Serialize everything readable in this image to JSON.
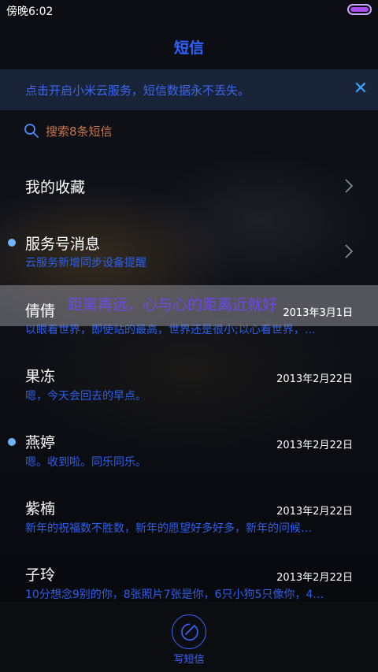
{
  "status_bar": {
    "time": "傍晚6:02"
  },
  "header": {
    "title": "短信"
  },
  "banner": {
    "text": "点击开启小米云服务，短信数据永不丢失。",
    "close_icon": "close-icon"
  },
  "search": {
    "text": "搜索8条短信",
    "icon": "search-icon"
  },
  "favorites": {
    "label": "我的收藏"
  },
  "service": {
    "title": "服务号消息",
    "subtitle": "云服务新增同步设备提醒"
  },
  "overlay": {
    "text": "距离再远，心与心的距离近就好"
  },
  "conversations": [
    {
      "name": "倩倩",
      "date": "2013年3月1日",
      "preview": "以眼看世界，即使站的最高，世界还是很小;以心看世界，…"
    },
    {
      "name": "果冻",
      "date": "2013年2月22日",
      "preview": "嗯，今天会回去的早点。"
    },
    {
      "name": "燕婷",
      "date": "2013年2月22日",
      "preview": "嗯。收到啦。同乐同乐。"
    },
    {
      "name": "紫楠",
      "date": "2013年2月22日",
      "preview": "新年的祝福数不胜数，新年的愿望好多好多，新年的问候…"
    },
    {
      "name": "子玲",
      "date": "2013年2月22日",
      "preview": "10分想念9别的你，8张照片7张是你，6只小狗5只像你，4…"
    }
  ],
  "bottom": {
    "compose_label": "写短信"
  },
  "colors": {
    "accent": "#2f63ff",
    "preview_blue": "#2b60ee",
    "unread_dot": "#6fb3ff",
    "search_text": "#c8774a"
  }
}
